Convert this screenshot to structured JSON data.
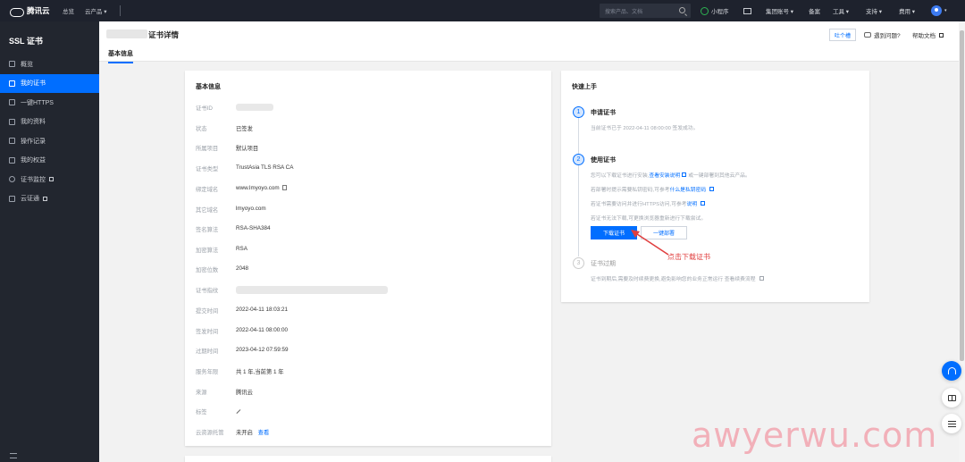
{
  "topbar": {
    "brand": "腾讯云",
    "nav": [
      "总览",
      "云产品 ▾"
    ],
    "search_placeholder": "搜索产品、文档",
    "items": {
      "miniprogram": "小程序",
      "group": "集团账号 ▾",
      "record": "备案",
      "tools": "工具 ▾",
      "support": "支持 ▾",
      "cost": "费用 ▾"
    }
  },
  "sidebar": {
    "title": "SSL 证书",
    "items": [
      {
        "label": "概览"
      },
      {
        "label": "我的证书"
      },
      {
        "label": "一键HTTPS"
      },
      {
        "label": "我的资料"
      },
      {
        "label": "操作记录"
      },
      {
        "label": "我的权益"
      },
      {
        "label": "证书监控"
      },
      {
        "label": "云证通"
      }
    ]
  },
  "header": {
    "title": "证书详情",
    "tab": "基本信息",
    "feedback_btn": "吐个槽",
    "problem_link": "遇到问题?",
    "help_link": "帮助文档"
  },
  "basic": {
    "title": "基本信息",
    "rows": [
      {
        "k": "证书ID",
        "v": ""
      },
      {
        "k": "状态",
        "v": "已签发"
      },
      {
        "k": "所属项目",
        "v": "默认项目"
      },
      {
        "k": "证书类型",
        "v": "TrustAsia TLS RSA CA"
      },
      {
        "k": "绑定域名",
        "v": "www.lmyoyo.com"
      },
      {
        "k": "其它域名",
        "v": "lmyoyo.com"
      },
      {
        "k": "签名算法",
        "v": "RSA-SHA384"
      },
      {
        "k": "加密算法",
        "v": "RSA"
      },
      {
        "k": "加密位数",
        "v": "2048"
      },
      {
        "k": "证书指纹",
        "v": ""
      },
      {
        "k": "提交时间",
        "v": "2022-04-11 18:03:21"
      },
      {
        "k": "签发时间",
        "v": "2022-04-11 08:00:00"
      },
      {
        "k": "过期时间",
        "v": "2023-04-12 07:59:59"
      },
      {
        "k": "服务年限",
        "v": "共 1 年,当前第 1 年"
      },
      {
        "k": "来源",
        "v": "腾讯云"
      },
      {
        "k": "标签",
        "v": ""
      },
      {
        "k": "云资源托管",
        "v": "未开启"
      }
    ],
    "view_link": "查看"
  },
  "quick": {
    "title": "快速上手",
    "steps": [
      {
        "num": "1",
        "title": "申请证书",
        "desc": "当前证书已于 2022-04-11 08:00:00 签发成功。"
      },
      {
        "num": "2",
        "title": "使用证书",
        "lines": [
          "您可以下载证书进行安装,",
          "查看安装说明",
          "或一键部署到其他云产品。",
          "若部署时提示需要私钥密码,可参考",
          "什么是私钥密码",
          "若证书需要访问并进行HTTPS访问,可参考",
          "说明",
          "若证书无法下载,可更换浏览器重新进行下载尝试。"
        ],
        "download_btn": "下载证书",
        "deploy_btn": "一键部署"
      },
      {
        "num": "3",
        "title": "证书过期",
        "desc": "证书到期后,需要及时续费更换,避免影响您的业务正常运行 查看续费流程"
      }
    ]
  },
  "annotation": "点击下载证书",
  "watermark": "awyerwu.com"
}
